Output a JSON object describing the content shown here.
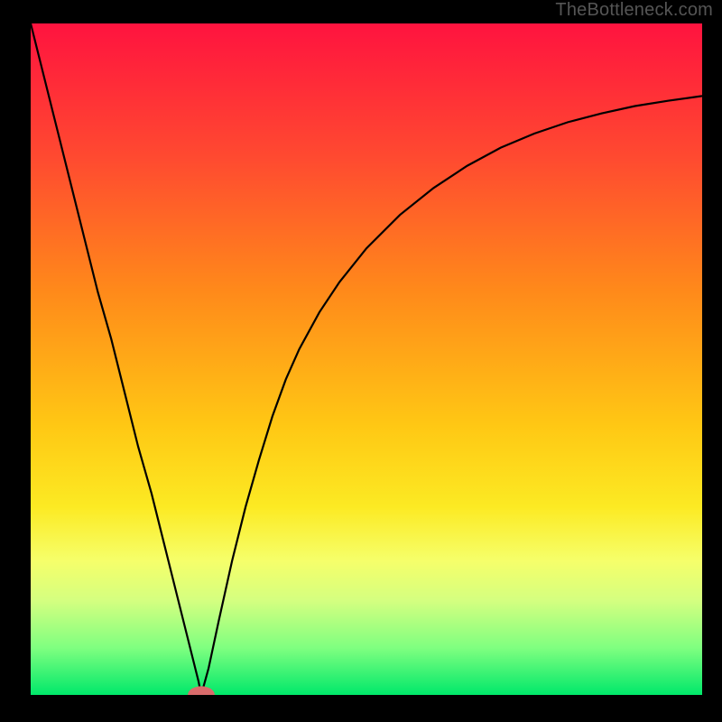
{
  "watermark": "TheBottleneck.com",
  "chart_data": {
    "type": "line",
    "title": "",
    "xlabel": "",
    "ylabel": "",
    "xlim": [
      0,
      100
    ],
    "ylim": [
      0,
      100
    ],
    "grid": false,
    "legend": false,
    "gradient_stops": [
      {
        "offset": 0,
        "color": "#ff133f"
      },
      {
        "offset": 20,
        "color": "#ff4a30"
      },
      {
        "offset": 40,
        "color": "#ff8a1a"
      },
      {
        "offset": 60,
        "color": "#ffc814"
      },
      {
        "offset": 72,
        "color": "#fcea23"
      },
      {
        "offset": 80,
        "color": "#f6ff6a"
      },
      {
        "offset": 86,
        "color": "#d4ff80"
      },
      {
        "offset": 93,
        "color": "#7fff80"
      },
      {
        "offset": 100,
        "color": "#00e86a"
      }
    ],
    "marker": {
      "x": 25.4,
      "y": 0,
      "color": "#d96b6b",
      "rx": 2.0,
      "ry": 1.3
    },
    "series": [
      {
        "name": "curve",
        "color": "#000000",
        "x": [
          0.0,
          2.0,
          4.0,
          6.0,
          8.0,
          10.0,
          12.0,
          14.0,
          16.0,
          18.0,
          20.0,
          22.0,
          23.0,
          24.0,
          25.0,
          25.4,
          26.5,
          28.0,
          30.0,
          32.0,
          34.0,
          36.0,
          38.0,
          40.0,
          43.0,
          46.0,
          50.0,
          55.0,
          60.0,
          65.0,
          70.0,
          75.0,
          80.0,
          85.0,
          90.0,
          95.0,
          100.0
        ],
        "y": [
          100.0,
          92.0,
          84.0,
          76.0,
          68.0,
          60.0,
          53.0,
          45.0,
          37.0,
          30.0,
          22.0,
          14.0,
          10.0,
          6.0,
          2.0,
          0.0,
          4.0,
          11.0,
          20.0,
          28.0,
          35.0,
          41.5,
          47.0,
          51.5,
          57.0,
          61.5,
          66.5,
          71.5,
          75.5,
          78.8,
          81.5,
          83.6,
          85.3,
          86.6,
          87.7,
          88.5,
          89.2
        ]
      }
    ]
  }
}
